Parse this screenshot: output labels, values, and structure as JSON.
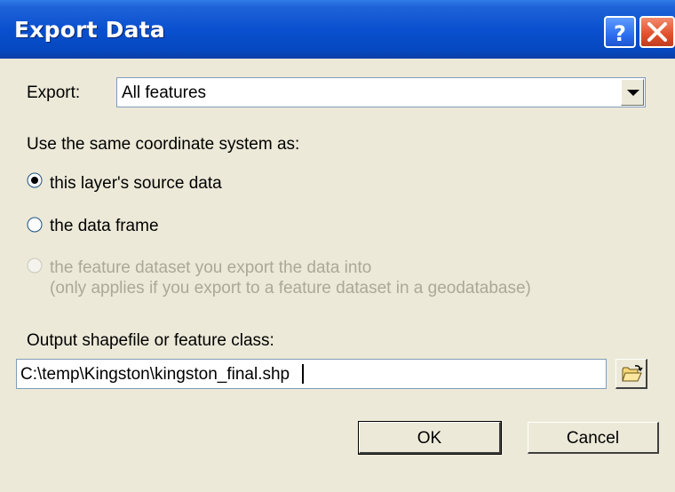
{
  "window": {
    "title": "Export Data",
    "help_button": "?",
    "close_button": "X"
  },
  "export": {
    "label": "Export:",
    "selected": "All features"
  },
  "coordinate_system": {
    "heading": "Use the same coordinate system as:",
    "options": [
      {
        "label": "this layer's source data",
        "selected": true,
        "enabled": true
      },
      {
        "label": "the data frame",
        "selected": false,
        "enabled": true
      },
      {
        "label": "the feature dataset you export the data into",
        "note": "(only applies if you export to a feature dataset in a geodatabase)",
        "selected": false,
        "enabled": false
      }
    ]
  },
  "output": {
    "label": "Output shapefile or feature class:",
    "path": "C:\\temp\\Kingston\\kingston_final.shp"
  },
  "buttons": {
    "ok": "OK",
    "cancel": "Cancel"
  },
  "icons": {
    "help": "help-icon",
    "close": "close-icon",
    "dropdown": "chevron-down-icon",
    "browse": "open-folder-icon"
  }
}
